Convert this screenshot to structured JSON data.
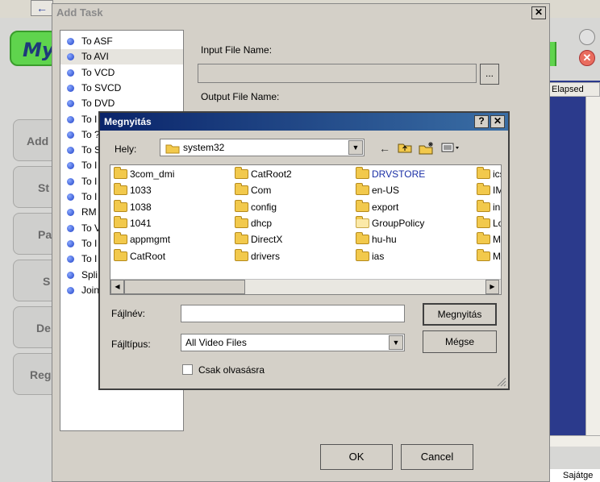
{
  "background_app": {
    "logo_text": "My",
    "side_buttons": [
      "Add",
      "St",
      "Pa",
      "S",
      "De",
      "Reg"
    ],
    "list_header": "Elapsed",
    "taskbar_text": "Sajátge"
  },
  "add_task": {
    "title": "Add Task",
    "close_glyph": "✕",
    "tasks": [
      "To ASF",
      "To AVI",
      "To VCD",
      "To SVCD",
      "To DVD",
      "To I",
      "To ?",
      "To S",
      "To I",
      "To I",
      "To I",
      "RM",
      "To V",
      "To I",
      "To I",
      "Spli",
      "Join"
    ],
    "selected_index": 1,
    "input_label": "Input File Name:",
    "output_label": "Output File Name:",
    "browse_label": "...",
    "ok_label": "OK",
    "cancel_label": "Cancel"
  },
  "open_dialog": {
    "title": "Megnyitás",
    "help_glyph": "?",
    "close_glyph": "✕",
    "location_label": "Hely:",
    "location_value": "system32",
    "toolbar_icons": [
      "back-arrow-icon",
      "up-folder-icon",
      "new-folder-icon",
      "view-menu-icon"
    ],
    "files": [
      {
        "name": "3com_dmi",
        "style": "normal"
      },
      {
        "name": "1033",
        "style": "normal"
      },
      {
        "name": "1038",
        "style": "normal"
      },
      {
        "name": "1041",
        "style": "normal"
      },
      {
        "name": "appmgmt",
        "style": "normal"
      },
      {
        "name": "CatRoot",
        "style": "normal"
      },
      {
        "name": "CatRoot2",
        "style": "normal"
      },
      {
        "name": "Com",
        "style": "normal"
      },
      {
        "name": "config",
        "style": "normal"
      },
      {
        "name": "dhcp",
        "style": "normal"
      },
      {
        "name": "DirectX",
        "style": "normal"
      },
      {
        "name": "drivers",
        "style": "normal"
      },
      {
        "name": "DRVSTORE",
        "style": "blue"
      },
      {
        "name": "en-US",
        "style": "normal"
      },
      {
        "name": "export",
        "style": "normal"
      },
      {
        "name": "GroupPolicy",
        "style": "light"
      },
      {
        "name": "hu-hu",
        "style": "normal"
      },
      {
        "name": "ias",
        "style": "normal"
      },
      {
        "name": "ics",
        "style": "normal"
      },
      {
        "name": "IM",
        "style": "normal"
      },
      {
        "name": "in",
        "style": "normal"
      },
      {
        "name": "Lo",
        "style": "normal"
      },
      {
        "name": "M",
        "style": "normal"
      },
      {
        "name": "M",
        "style": "normal"
      }
    ],
    "filename_label": "Fájlnév:",
    "filename_value": "",
    "open_button": "Megnyitás",
    "filetype_label": "Fájltípus:",
    "filetype_value": "All Video Files",
    "cancel_button": "Mégse",
    "readonly_label": "Csak olvasásra",
    "readonly_checked": false
  }
}
